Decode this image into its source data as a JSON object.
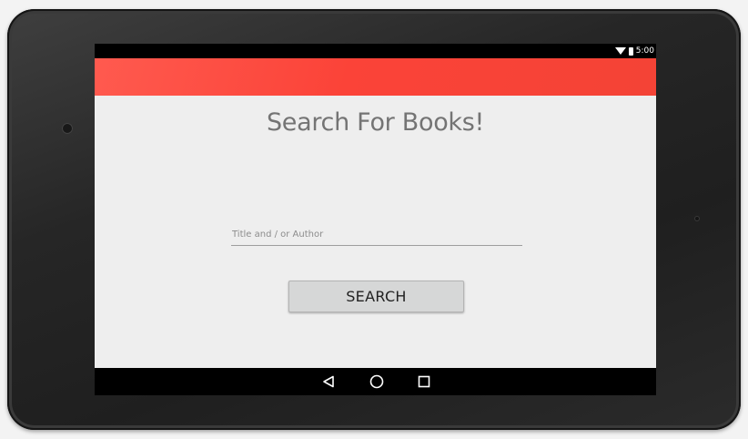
{
  "status_bar": {
    "time": "5:00",
    "icons": [
      "wifi-icon",
      "battery-icon"
    ]
  },
  "main": {
    "title": "Search For Books!",
    "search": {
      "placeholder": "Title and / or Author",
      "value": ""
    },
    "search_button_label": "SEARCH"
  },
  "navigation": {
    "buttons": [
      "back-icon",
      "home-icon",
      "recent-apps-icon"
    ]
  },
  "colors": {
    "app_bar": "#f44336",
    "background": "#eeeeee",
    "button": "#d6d7d7"
  }
}
